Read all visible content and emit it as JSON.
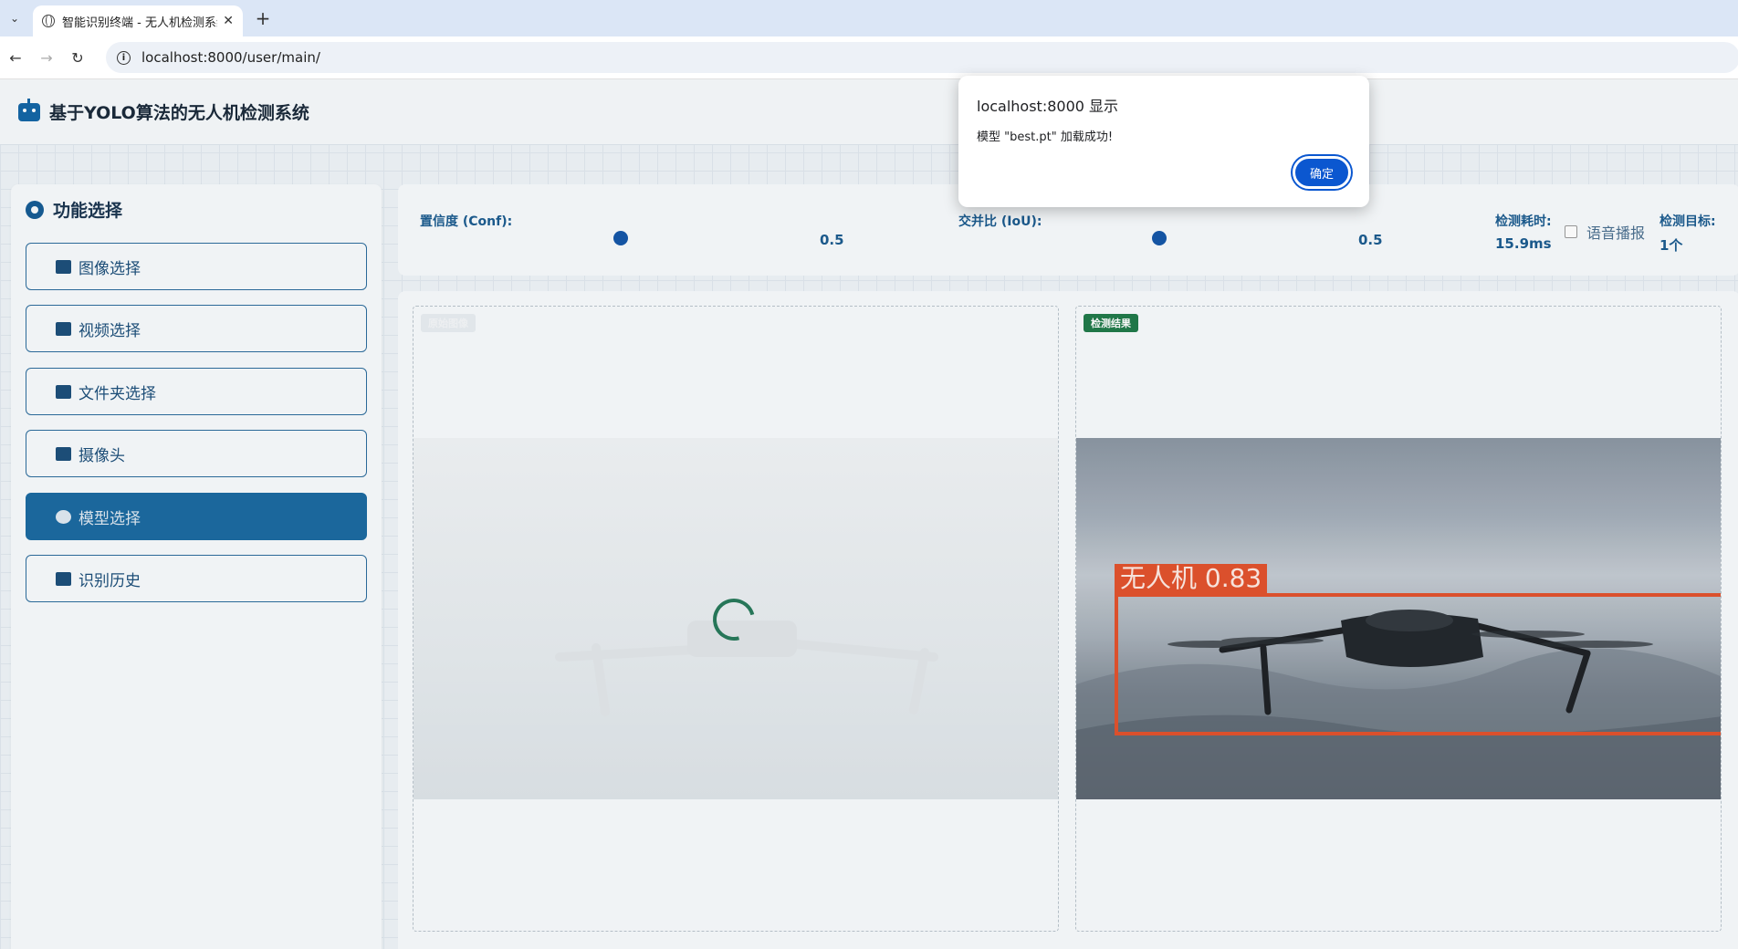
{
  "browser": {
    "tab_title": "智能识别终端 - 无人机检测系统",
    "url": "localhost:8000/user/main/"
  },
  "header": {
    "title": "基于YOLO算法的无人机检测系统"
  },
  "sidebar": {
    "title": "功能选择",
    "items": [
      {
        "label": "图像选择",
        "icon": "image-icon"
      },
      {
        "label": "视频选择",
        "icon": "video-icon"
      },
      {
        "label": "文件夹选择",
        "icon": "folder-icon"
      },
      {
        "label": "摄像头",
        "icon": "camera-icon"
      },
      {
        "label": "模型选择",
        "icon": "brain-icon",
        "active": true
      },
      {
        "label": "识别历史",
        "icon": "history-icon"
      }
    ]
  },
  "controls": {
    "conf_label": "置信度 (Conf):",
    "conf_value": "0.5",
    "iou_label": "交并比 (IoU):",
    "iou_value": "0.5",
    "time_label": "检测耗时:",
    "time_value": "15.9ms",
    "voice_label": "语音播报",
    "target_label": "检测目标:",
    "target_value": "1个"
  },
  "panels": {
    "original_badge": "原始图像",
    "result_badge": "检测结果",
    "detection_label": "无人机 0.83"
  },
  "dialog": {
    "title": "localhost:8000 显示",
    "message": "模型 \"best.pt\" 加载成功!",
    "ok_label": "确定"
  },
  "colors": {
    "accent": "#1b6aa0",
    "detection": "#e2522d",
    "dialog_button": "#0b57d0"
  }
}
